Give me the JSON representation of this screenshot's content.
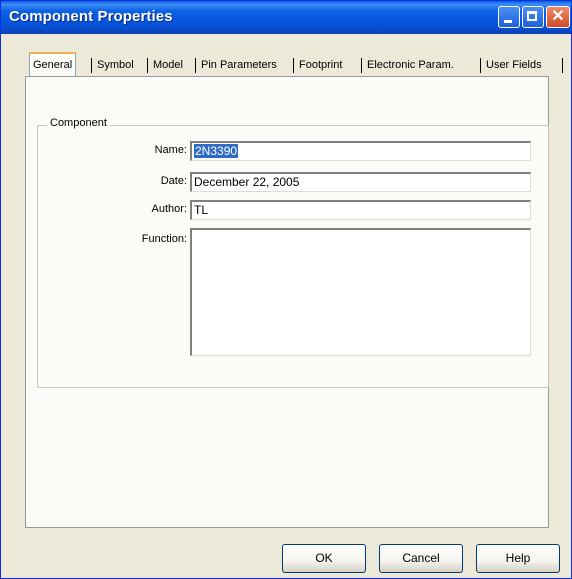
{
  "window": {
    "title": "Component Properties"
  },
  "tabs": [
    "General",
    "Symbol",
    "Model",
    "Pin Parameters",
    "Footprint",
    "Electronic Param.",
    "User Fields"
  ],
  "active_tab": "General",
  "group": {
    "label": "Component"
  },
  "fields": {
    "name": {
      "label": "Name:",
      "value": "2N3390"
    },
    "date": {
      "label": "Date:",
      "value": "December 22, 2005"
    },
    "author": {
      "label": "Author:",
      "value": "TL"
    },
    "function": {
      "label": "Function:",
      "value": ""
    }
  },
  "buttons": {
    "ok": "OK",
    "cancel": "Cancel",
    "help": "Help"
  },
  "colors": {
    "title_bar": "#0553d9",
    "selection": "#316ac5",
    "tab_highlight": "#f0b44c",
    "window_bg": "#ece9d8"
  }
}
